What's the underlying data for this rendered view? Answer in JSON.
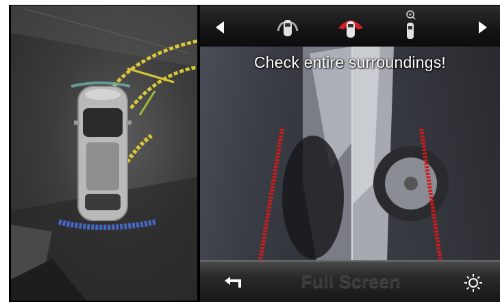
{
  "camera_view": {
    "warning_text": "Check entire surroundings!",
    "view_selector": {
      "prev_icon": "triangle-left-icon",
      "next_icon": "triangle-right-icon",
      "views": [
        {
          "icon": "car-side-sensors-icon",
          "selected": false
        },
        {
          "icon": "car-front-view-icon",
          "selected": true
        },
        {
          "icon": "car-zoom-icon",
          "selected": false
        }
      ]
    },
    "bottom_bar": {
      "back_icon": "back-arrow-icon",
      "fullscreen_label": "Full Screen",
      "brightness_icon": "brightness-sun-icon"
    },
    "colors": {
      "selected_view_accent": "#d0202a",
      "guideline_red": "#d41a1a",
      "guideline_yellow": "#d8c836",
      "sensor_blue": "#4a6ed8"
    }
  }
}
